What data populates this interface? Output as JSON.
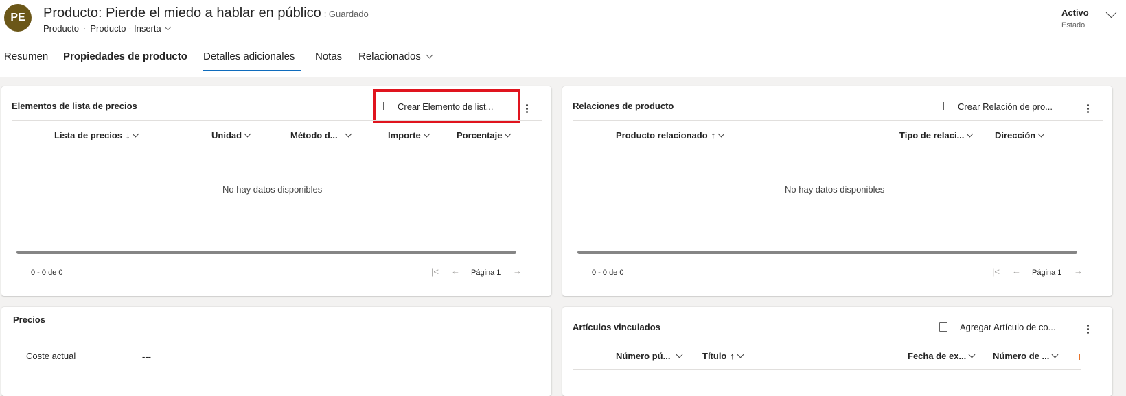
{
  "header": {
    "avatar_initials": "PE",
    "title": "Producto: Pierde el miedo a hablar en público",
    "saved": ": Guardado",
    "entity": "Producto",
    "separator": "·",
    "form": "Producto - Inserta",
    "status_value": "Activo",
    "status_label": "Estado"
  },
  "tabs": [
    {
      "label": "Resumen"
    },
    {
      "label": "Propiedades de producto"
    },
    {
      "label": "Detalles adicionales"
    },
    {
      "label": "Notas"
    },
    {
      "label": "Relacionados"
    }
  ],
  "price_list_items": {
    "title": "Elementos de lista de precios",
    "new_label": "Crear Elemento de list...",
    "columns": [
      "Lista de precios",
      "Unidad",
      "Método d...",
      "Importe",
      "Porcentaje"
    ],
    "sort_arrow": "↓",
    "empty": "No hay datos disponibles",
    "count": "0 - 0 de 0",
    "page": "Página 1"
  },
  "product_relations": {
    "title": "Relaciones de producto",
    "new_label": "Crear Relación de pro...",
    "columns": [
      "Producto relacionado",
      "Tipo de relaci...",
      "Dirección"
    ],
    "sort_arrow": "↑",
    "empty": "No hay datos disponibles",
    "count": "0 - 0 de 0",
    "page": "Página 1"
  },
  "pricing": {
    "title": "Precios",
    "field_label": "Coste actual",
    "field_value": "---"
  },
  "linked_articles": {
    "title": "Artículos vinculados",
    "add_label": "Agregar Artículo de co...",
    "columns": [
      "Número pú...",
      "Título",
      "Fecha de ex...",
      "Número de ..."
    ],
    "sort_arrow": "↑"
  },
  "colors": {
    "accent": "#0f6cbd",
    "highlight": "#e0141e",
    "avatar": "#6b5718"
  }
}
